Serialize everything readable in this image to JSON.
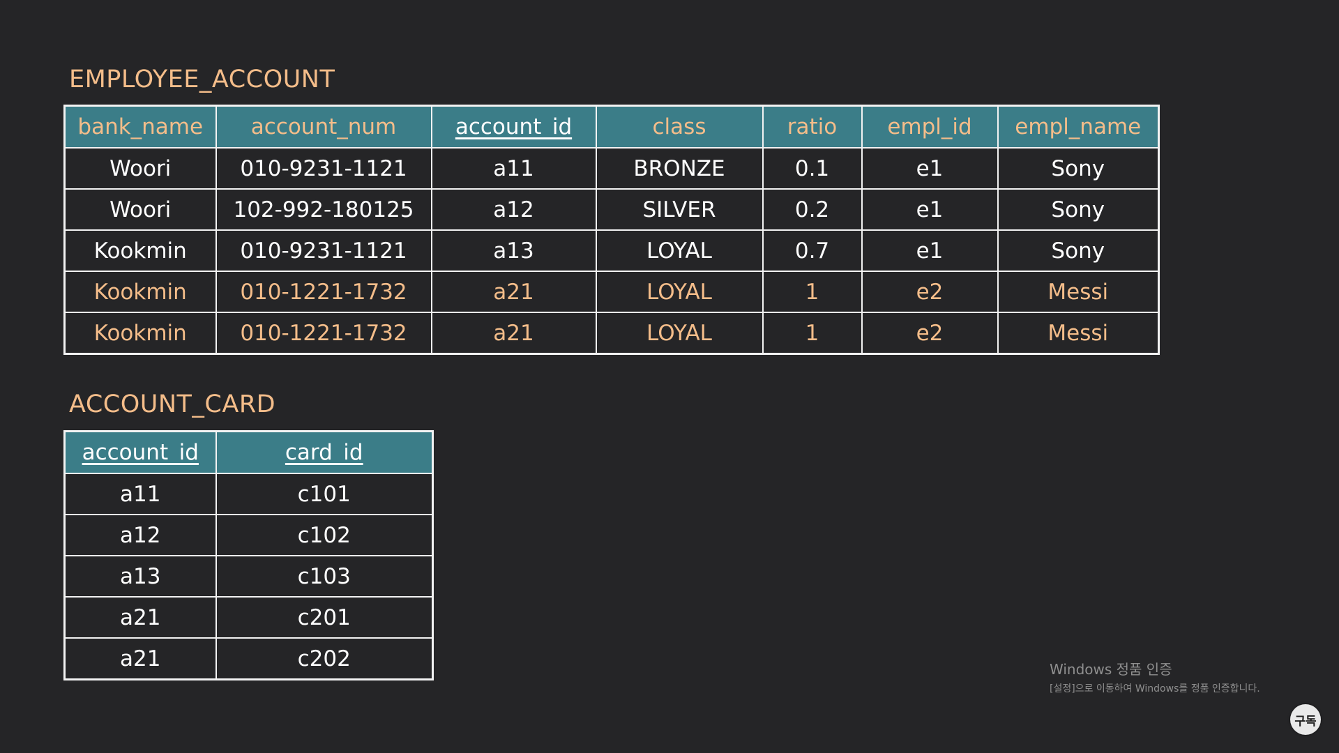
{
  "employee_account": {
    "title": "EMPLOYEE_ACCOUNT",
    "columns": [
      {
        "label": "bank_name",
        "key": false
      },
      {
        "label": "account_num",
        "key": false
      },
      {
        "label": "account_id",
        "key": true
      },
      {
        "label": "class",
        "key": false
      },
      {
        "label": "ratio",
        "key": false
      },
      {
        "label": "empl_id",
        "key": false
      },
      {
        "label": "empl_name",
        "key": false
      }
    ],
    "rows": [
      {
        "highlight": false,
        "cells": [
          "Woori",
          "010-9231-1121",
          "a11",
          "BRONZE",
          "0.1",
          "e1",
          "Sony"
        ]
      },
      {
        "highlight": false,
        "cells": [
          "Woori",
          "102-992-180125",
          "a12",
          "SILVER",
          "0.2",
          "e1",
          "Sony"
        ]
      },
      {
        "highlight": false,
        "cells": [
          "Kookmin",
          "010-9231-1121",
          "a13",
          "LOYAL",
          "0.7",
          "e1",
          "Sony"
        ]
      },
      {
        "highlight": true,
        "cells": [
          "Kookmin",
          "010-1221-1732",
          "a21",
          "LOYAL",
          "1",
          "e2",
          "Messi"
        ]
      },
      {
        "highlight": true,
        "cells": [
          "Kookmin",
          "010-1221-1732",
          "a21",
          "LOYAL",
          "1",
          "e2",
          "Messi"
        ]
      }
    ]
  },
  "account_card": {
    "title": "ACCOUNT_CARD",
    "columns": [
      {
        "label": "account_id",
        "key": true
      },
      {
        "label": "card_id",
        "key": true
      }
    ],
    "rows": [
      {
        "highlight": false,
        "cells": [
          "a11",
          "c101"
        ]
      },
      {
        "highlight": false,
        "cells": [
          "a12",
          "c102"
        ]
      },
      {
        "highlight": false,
        "cells": [
          "a13",
          "c103"
        ]
      },
      {
        "highlight": false,
        "cells": [
          "a21",
          "c201"
        ]
      },
      {
        "highlight": false,
        "cells": [
          "a21",
          "c202"
        ]
      }
    ]
  },
  "watermark": {
    "title": "Windows 정품 인증",
    "subtitle": "[설정]으로 이동하여 Windows를 정품 인증합니다."
  },
  "subscribe": {
    "label": "구독"
  },
  "colors": {
    "background": "#252527",
    "header_bg": "#3b7d88",
    "accent": "#f4bd8a",
    "text": "#ffffff"
  }
}
